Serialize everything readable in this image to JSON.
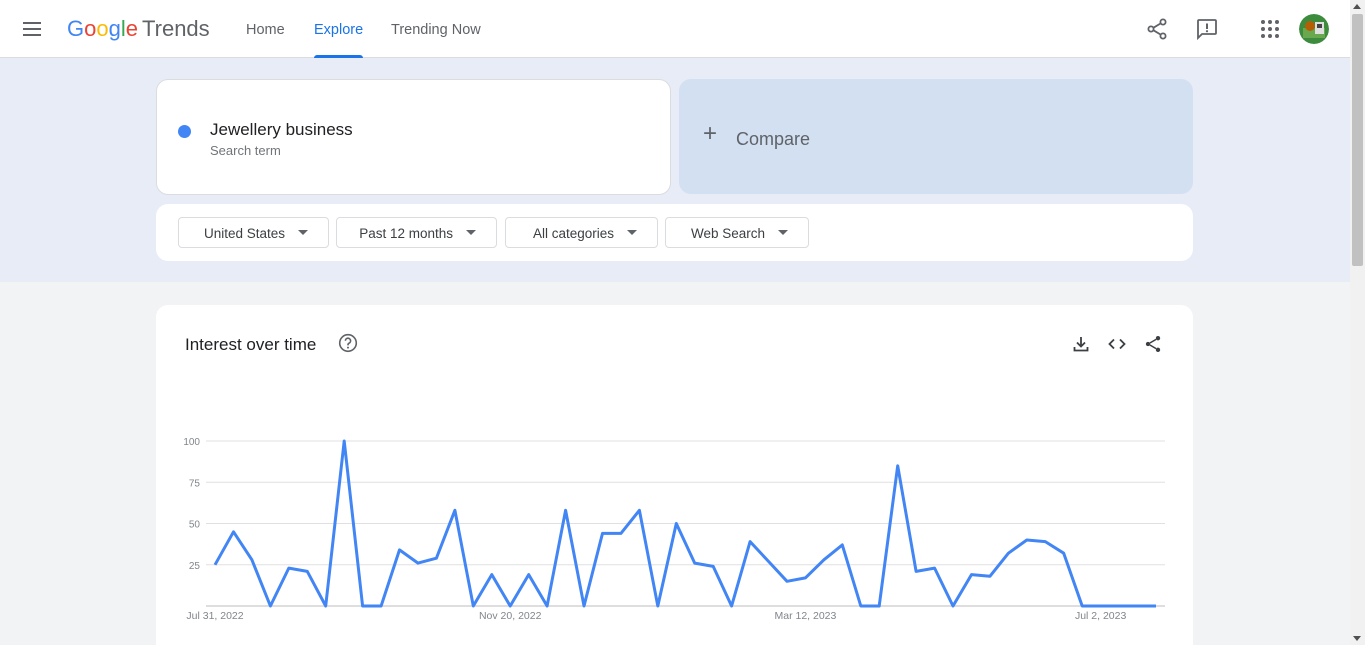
{
  "header": {
    "logo_google": [
      "G",
      "o",
      "o",
      "g",
      "l",
      "e"
    ],
    "logo_trends": "Trends",
    "nav": [
      {
        "label": "Home",
        "active": false
      },
      {
        "label": "Explore",
        "active": true
      },
      {
        "label": "Trending Now",
        "active": false
      }
    ],
    "icons": [
      "menu-icon",
      "share-icon",
      "feedback-icon",
      "apps-icon",
      "avatar"
    ]
  },
  "search": {
    "term": "Jewellery business",
    "term_type": "Search term",
    "term_color": "#4285f4",
    "compare_plus": "+",
    "compare_label": "Compare"
  },
  "filters": [
    {
      "label": "United States"
    },
    {
      "label": "Past 12 months"
    },
    {
      "label": "All categories"
    },
    {
      "label": "Web Search"
    }
  ],
  "chart": {
    "title": "Interest over time",
    "tools": [
      "download-icon",
      "embed-icon",
      "share-icon"
    ]
  },
  "chart_data": {
    "type": "line",
    "title": "Interest over time",
    "xlabel": "",
    "ylabel": "",
    "ylim": [
      0,
      100
    ],
    "yticks": [
      25,
      50,
      75,
      100
    ],
    "xtick_labels": [
      "Jul 31, 2022",
      "Nov 20, 2022",
      "Mar 12, 2023",
      "Jul 2, 2023"
    ],
    "xtick_indices": [
      0,
      16,
      32,
      48
    ],
    "grid": true,
    "line_color": "#4285f4",
    "series": [
      {
        "name": "Jewellery business",
        "values": [
          25,
          45,
          28,
          0,
          23,
          21,
          0,
          100,
          0,
          0,
          34,
          26,
          29,
          58,
          0,
          19,
          0,
          19,
          0,
          58,
          0,
          44,
          44,
          58,
          0,
          50,
          26,
          24,
          0,
          39,
          27,
          15,
          17,
          28,
          37,
          0,
          0,
          85,
          21,
          23,
          0,
          19,
          18,
          32,
          40,
          39,
          32,
          0,
          0,
          0,
          0,
          0
        ]
      }
    ]
  }
}
